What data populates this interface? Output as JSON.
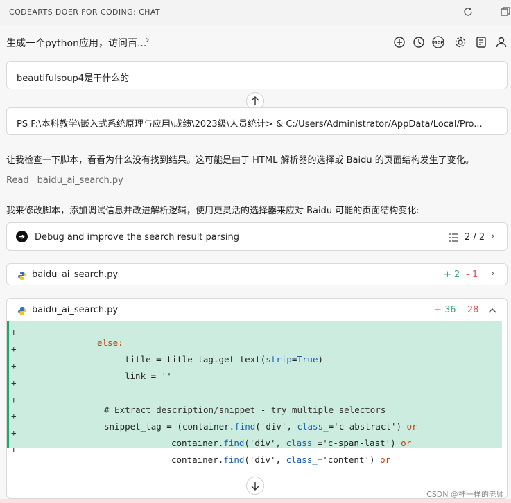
{
  "titlebar": {
    "title": "CODEARTS DOER FOR CODING: CHAT"
  },
  "header": {
    "session_title": "生成一个python应用，访问百..."
  },
  "messages": {
    "user_prompt": "beautifulsoup4是干什么的",
    "terminal_cmd": "PS F:\\本科教学\\嵌入式系统原理与应用\\成绩\\2023级\\人员统计> & C:/Users/Administrator/AppData/Local/Pro...",
    "para1": "让我检查一下脚本，看看为什么没有找到结果。这可能是由于 HTML 解析器的选择或 Baidu 的页面结构发生了变化。",
    "read_label": "Read",
    "read_file": "baidu_ai_search.py",
    "para2": "我来修改脚本，添加调试信息并改进解析逻辑，使用更灵活的选择器来应对 Baidu 可能的页面结构变化:"
  },
  "task": {
    "label": "Debug and improve the search result parsing",
    "progress": "2 / 2"
  },
  "file1": {
    "name": "baidu_ai_search.py",
    "added": "+ 2",
    "removed": "- 1"
  },
  "file2": {
    "name": "baidu_ai_search.py",
    "added": "+ 36",
    "removed": "- 28"
  },
  "code": {
    "line0": "else:",
    "line1_a": "title = title_tag.get_text(",
    "line1_p": "strip",
    "line1_b": "=",
    "line1_v": "True",
    "line1_c": ")",
    "line2": "link = ''",
    "line3": "",
    "line4": "# Extract description/snippet - try multiple selectors",
    "line5_a": "snippet_tag = (container.",
    "line5_f": "find",
    "line5_b": "('div', ",
    "line5_p": "class_",
    "line5_c": "='c-abstract') ",
    "line5_k": "or",
    "line6_a": "container.",
    "line6_f": "find",
    "line6_b": "('div', ",
    "line6_p": "class_",
    "line6_c": "='c-span-last') ",
    "line6_k": "or",
    "line7_a": "container.",
    "line7_f": "find",
    "line7_b": "('div', ",
    "line7_p": "class_",
    "line7_c": "='content') ",
    "line7_k": "or",
    "plus": "+"
  },
  "watermark": "CSDN @神一样的老师",
  "icons": [
    "refresh-icon",
    "new-window-icon",
    "add-icon",
    "history-icon",
    "mcp-icon",
    "settings-icon",
    "notes-icon",
    "user-icon",
    "chevron-right-icon",
    "arrow-up-icon",
    "arrow-down-icon",
    "arrow-right-circle-icon",
    "list-icon",
    "python-icon",
    "chevron-up-icon"
  ]
}
